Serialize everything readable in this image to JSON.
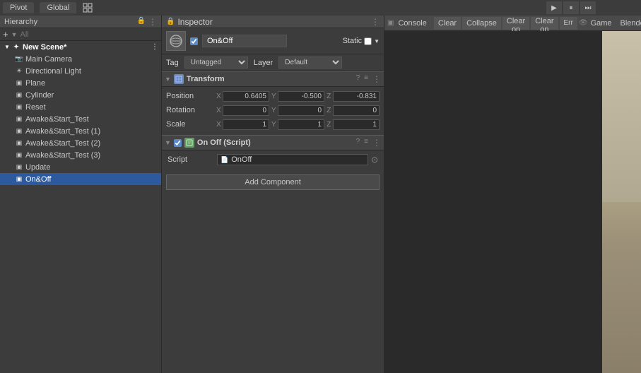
{
  "topbar": {
    "tabs": [
      {
        "label": "Pivot",
        "active": false
      },
      {
        "label": "Global",
        "active": false
      }
    ],
    "grid_icon": "⊞"
  },
  "playControls": {
    "play_label": "▶",
    "pause_label": "⏸",
    "step_label": "⏭"
  },
  "hierarchy": {
    "title": "Hierarchy",
    "search_placeholder": "All",
    "scene": "New Scene*",
    "items": [
      {
        "label": "Main Camera",
        "indent": 2,
        "icon": "📷",
        "id": "main-camera"
      },
      {
        "label": "Directional Light",
        "indent": 2,
        "icon": "💡",
        "id": "directional-light"
      },
      {
        "label": "Plane",
        "indent": 2,
        "icon": "◻",
        "id": "plane"
      },
      {
        "label": "Cylinder",
        "indent": 2,
        "icon": "◻",
        "id": "cylinder"
      },
      {
        "label": "Reset",
        "indent": 2,
        "icon": "◻",
        "id": "reset"
      },
      {
        "label": "Awake&Start_Test",
        "indent": 2,
        "icon": "◻",
        "id": "awake-start"
      },
      {
        "label": "Awake&Start_Test (1)",
        "indent": 2,
        "icon": "◻",
        "id": "awake-start-1"
      },
      {
        "label": "Awake&Start_Test (2)",
        "indent": 2,
        "icon": "◻",
        "id": "awake-start-2"
      },
      {
        "label": "Awake&Start_Test (3)",
        "indent": 2,
        "icon": "◻",
        "id": "awake-start-3"
      },
      {
        "label": "Update",
        "indent": 2,
        "icon": "◻",
        "id": "update"
      },
      {
        "label": "On&Off",
        "indent": 2,
        "icon": "◻",
        "id": "on-off",
        "selected": true
      }
    ]
  },
  "inspector": {
    "title": "Inspector",
    "object_name": "On&Off",
    "static_label": "Static",
    "static_checked": false,
    "tag_label": "Tag",
    "tag_value": "Untagged",
    "layer_label": "Layer",
    "layer_value": "Default",
    "transform": {
      "title": "Transform",
      "position": {
        "x": "0.6405",
        "y": "-0.500",
        "z": "-0.831"
      },
      "rotation": {
        "x": "0",
        "y": "0",
        "z": "0"
      },
      "scale": {
        "x": "1",
        "y": "1",
        "z": "1"
      },
      "x_label": "X",
      "y_label": "Y",
      "z_label": "Z",
      "position_label": "Position",
      "rotation_label": "Rotation",
      "scale_label": "Scale"
    },
    "script_component": {
      "title": "On Off (Script)",
      "script_label": "Script",
      "script_value": "OnOff",
      "enabled": true
    },
    "add_component_label": "Add Component"
  },
  "console": {
    "title": "Console",
    "clear_label": "Clear",
    "collapse_label": "Collapse",
    "clear_on_play_label": "Clear on Play",
    "clear_on_build_label": "Clear on Build",
    "error_pause_label": "Err"
  },
  "game": {
    "title": "Game",
    "display_label": "Blended"
  }
}
